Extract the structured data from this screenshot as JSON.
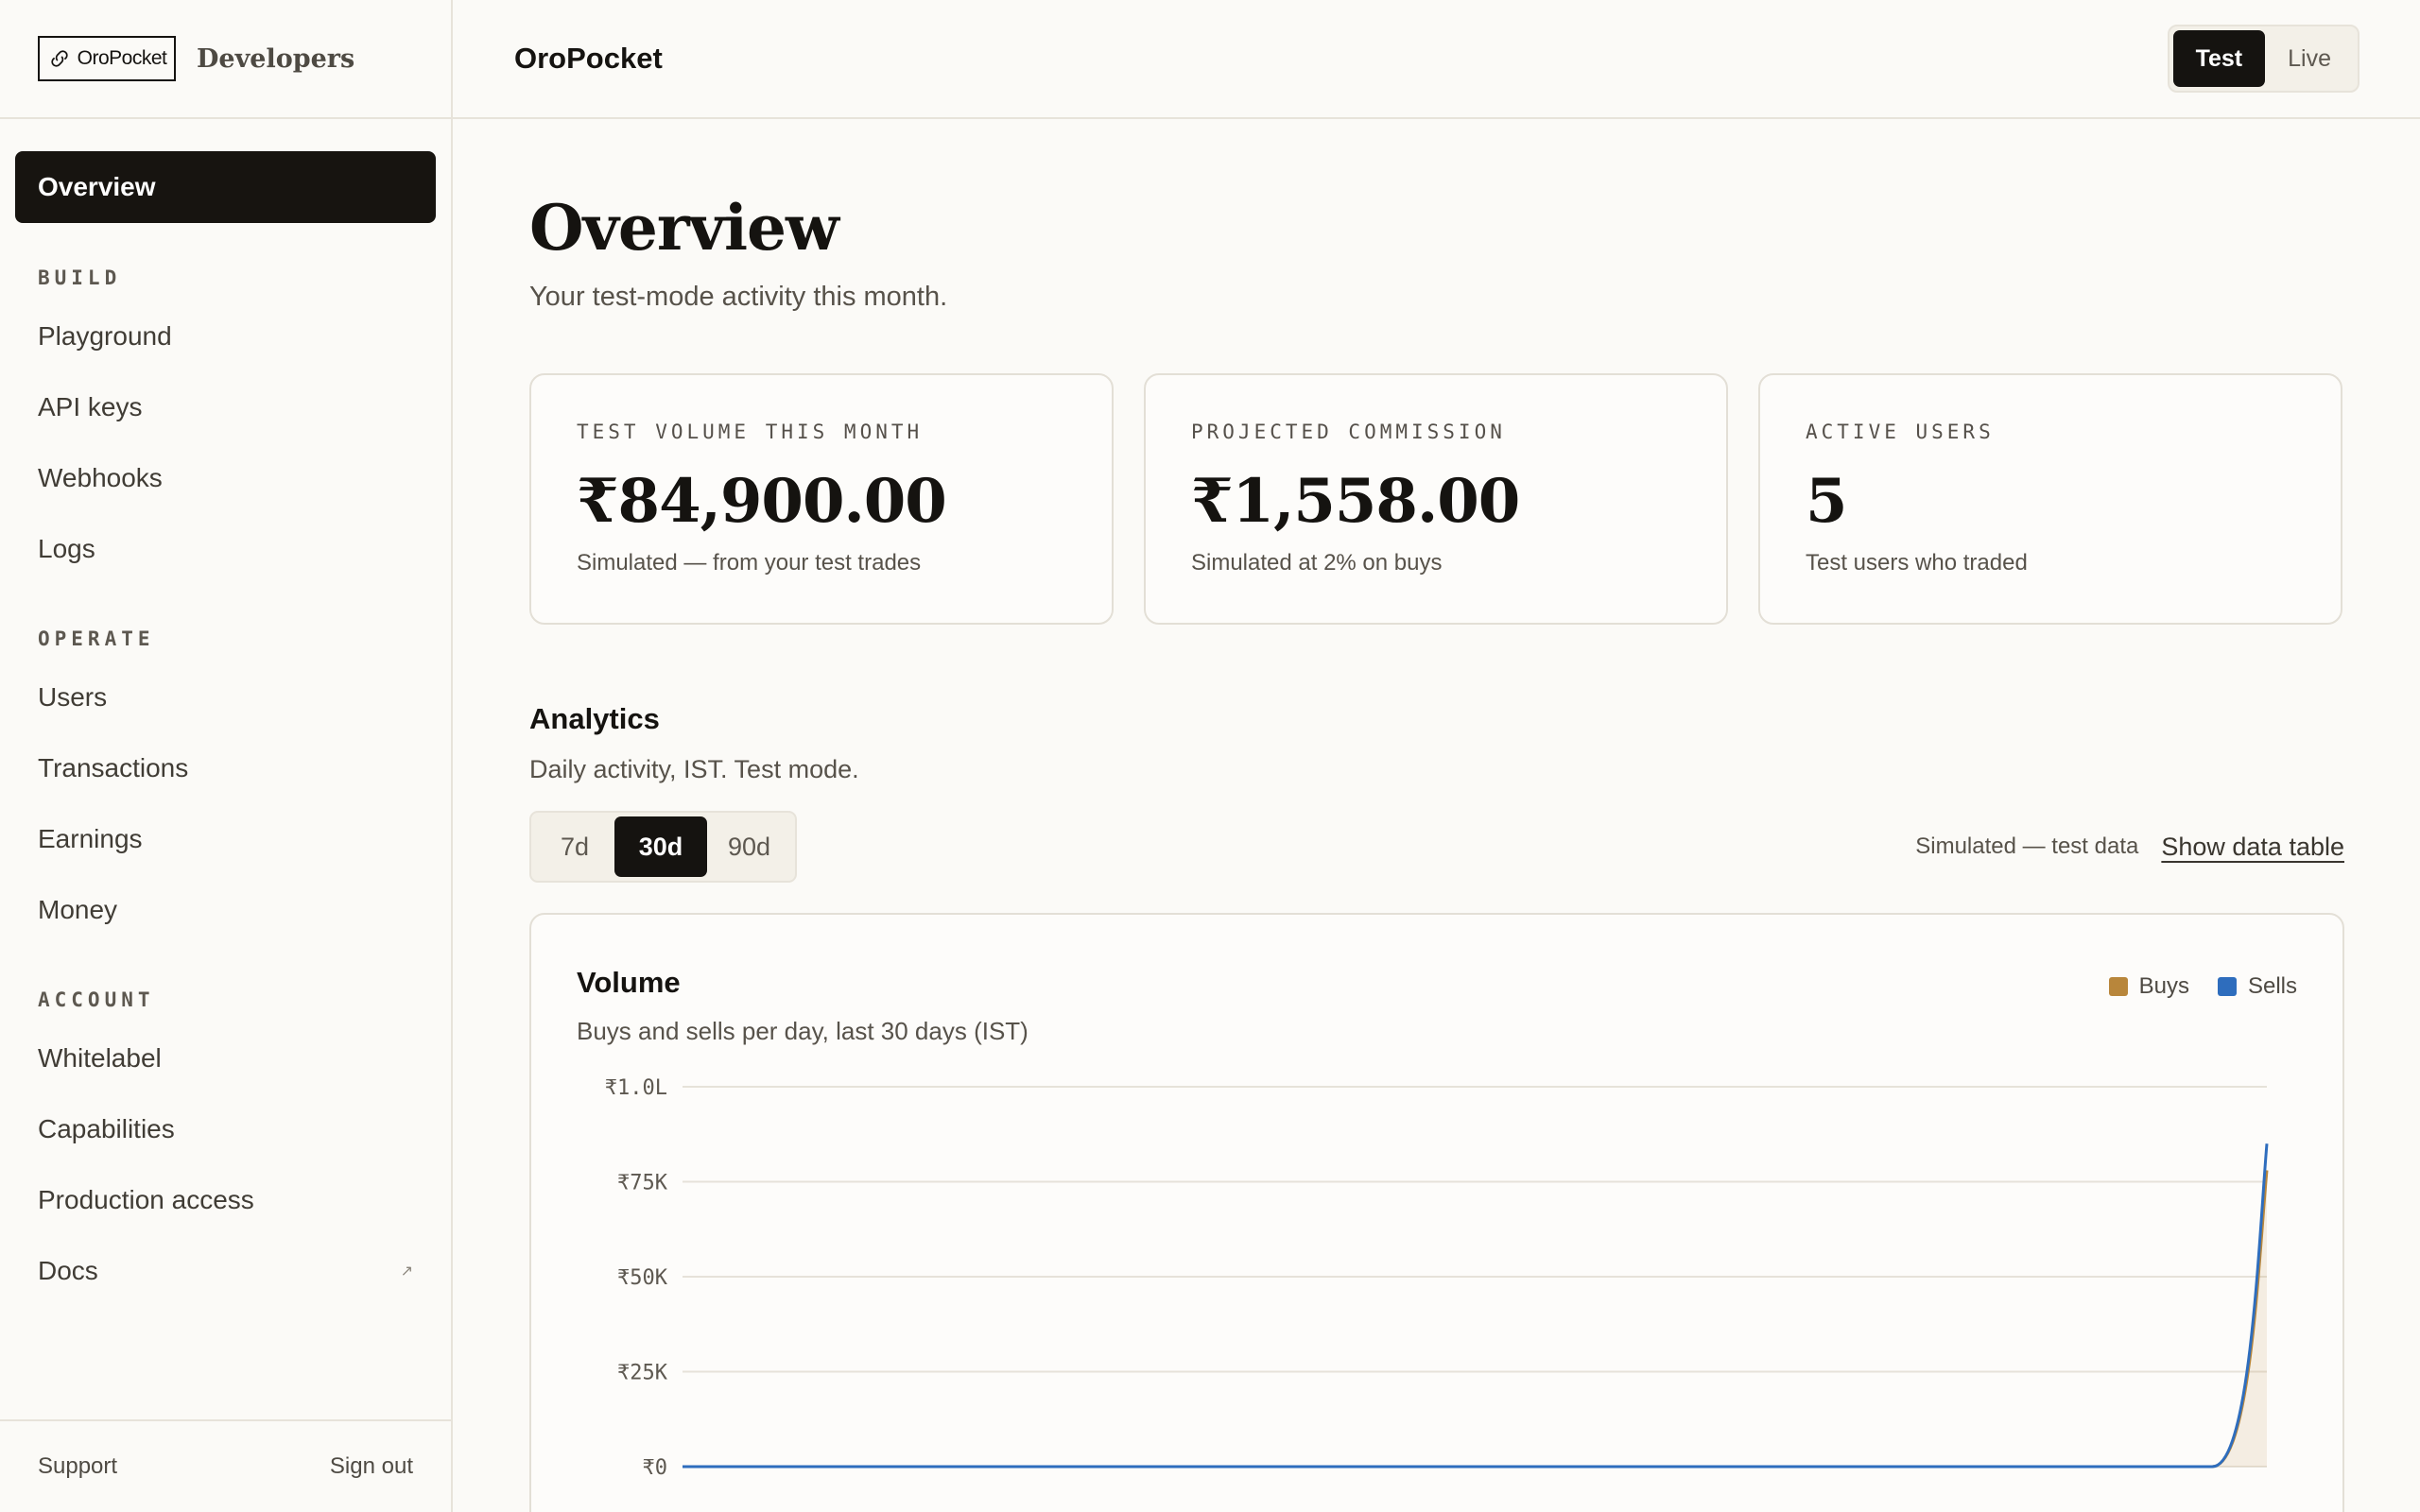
{
  "brand": {
    "logo_text": "OroPocket",
    "section": "Developers"
  },
  "sidebar": {
    "active": "Overview",
    "sections": [
      {
        "label": "BUILD",
        "items": [
          {
            "label": "Playground"
          },
          {
            "label": "API keys"
          },
          {
            "label": "Webhooks"
          },
          {
            "label": "Logs"
          }
        ]
      },
      {
        "label": "OPERATE",
        "items": [
          {
            "label": "Users"
          },
          {
            "label": "Transactions"
          },
          {
            "label": "Earnings"
          },
          {
            "label": "Money"
          }
        ]
      },
      {
        "label": "ACCOUNT",
        "items": [
          {
            "label": "Whitelabel"
          },
          {
            "label": "Capabilities"
          },
          {
            "label": "Production access"
          },
          {
            "label": "Docs",
            "external": "↗"
          }
        ]
      }
    ],
    "footer": {
      "support": "Support",
      "sign_out": "Sign out"
    }
  },
  "topbar": {
    "title": "OroPocket",
    "mode": {
      "test": "Test",
      "live": "Live",
      "selected": "Test"
    }
  },
  "page": {
    "title": "Overview",
    "subtitle": "Your test-mode activity this month."
  },
  "cards": [
    {
      "label": "TEST VOLUME THIS MONTH",
      "value": "₹84,900.00",
      "note": "Simulated — from your test trades"
    },
    {
      "label": "PROJECTED COMMISSION",
      "value": "₹1,558.00",
      "note": "Simulated at 2% on buys"
    },
    {
      "label": "ACTIVE USERS",
      "value": "5",
      "note": "Test users who traded"
    }
  ],
  "analytics": {
    "title": "Analytics",
    "subtitle": "Daily activity, IST. Test mode.",
    "ranges": [
      "7d",
      "30d",
      "90d"
    ],
    "selected_range": "30d",
    "sim_note": "Simulated — test data",
    "show_table": "Show data table"
  },
  "colors": {
    "buys": "#b8863b",
    "sells": "#2e6dbd",
    "accent_dark": "#151310"
  },
  "chart_data": {
    "type": "area",
    "title": "Volume",
    "subtitle": "Buys and sells per day, last 30 days (IST)",
    "y_ticks": [
      "₹0",
      "₹25K",
      "₹50K",
      "₹75K",
      "₹1.0L"
    ],
    "ylim": [
      0,
      100000
    ],
    "x": [
      1,
      2,
      3,
      4,
      5,
      6,
      7,
      8,
      9,
      10,
      11,
      12,
      13,
      14,
      15,
      16,
      17,
      18,
      19,
      20,
      21,
      22,
      23,
      24,
      25,
      26,
      27,
      28,
      29,
      30
    ],
    "series": [
      {
        "name": "Buys",
        "values": [
          0,
          0,
          0,
          0,
          0,
          0,
          0,
          0,
          0,
          0,
          0,
          0,
          0,
          0,
          0,
          0,
          0,
          0,
          0,
          0,
          0,
          0,
          0,
          0,
          0,
          0,
          0,
          0,
          0,
          78000
        ]
      },
      {
        "name": "Sells",
        "values": [
          0,
          0,
          0,
          0,
          0,
          0,
          0,
          0,
          0,
          0,
          0,
          0,
          0,
          0,
          0,
          0,
          0,
          0,
          0,
          0,
          0,
          0,
          0,
          0,
          0,
          0,
          0,
          0,
          0,
          85000
        ]
      }
    ],
    "grid": true,
    "legend": "top-right"
  }
}
